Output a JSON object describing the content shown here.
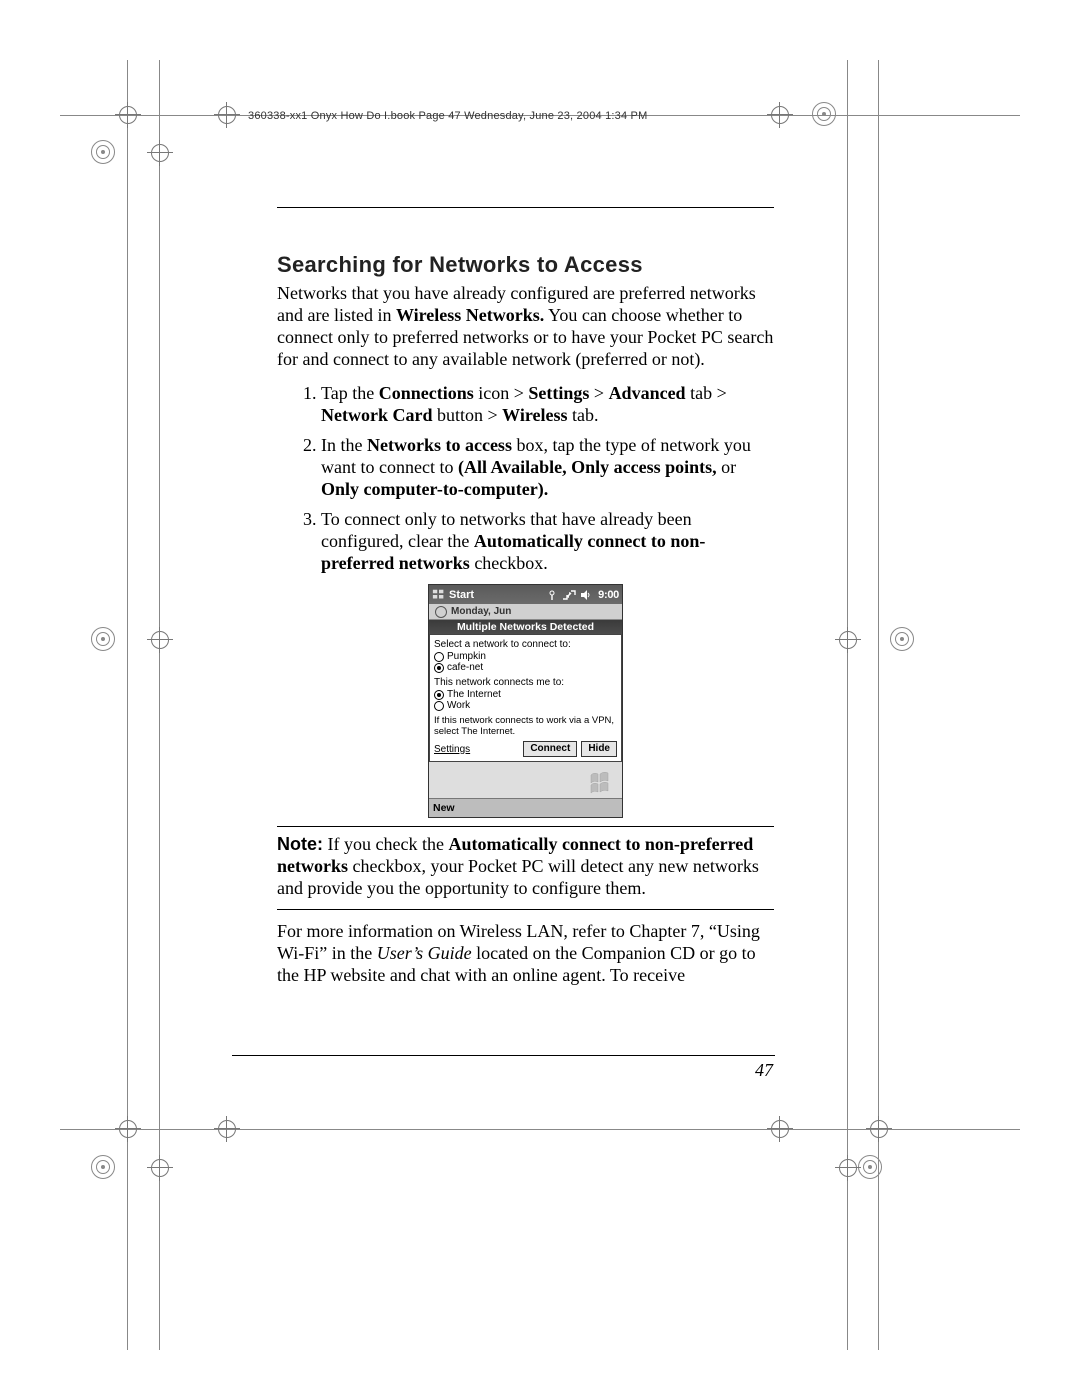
{
  "meta_line": "360338-xx1 Onyx How Do I.book  Page 47  Wednesday, June 23, 2004  1:34 PM",
  "page_number": "47",
  "heading": "Searching for Networks to Access",
  "intro": {
    "pre": "Networks that you have already configured are preferred networks and are listed in ",
    "b1": "Wireless Networks.",
    "post": " You can choose whether to connect only to preferred networks or to have your Pocket PC search for and connect to any available network (preferred or not)."
  },
  "steps": {
    "s1": {
      "pre": "Tap the ",
      "b1": "Connections",
      "mid1": " icon > ",
      "b2": "Settings",
      "mid2": " > ",
      "b3": "Advanced",
      "mid3": " tab > ",
      "b4": "Network Card",
      "mid4": " button > ",
      "b5": "Wireless",
      "post": " tab."
    },
    "s2": {
      "pre": "In the ",
      "b1": "Networks to access",
      "mid1": " box, tap the type of network you want to connect to ",
      "b2": "(All Available, Only access points,",
      "mid2": " or ",
      "b3": "Only computer-to-computer)."
    },
    "s3": {
      "pre": "To connect only to networks that have already been configured, clear the ",
      "b1": "Automatically connect to non-preferred networks",
      "post": " checkbox."
    }
  },
  "ppc": {
    "start": "Start",
    "clock": "9:00",
    "date_strip": "Monday, Jun",
    "header": "Multiple Networks Detected",
    "select_label": "Select a network to connect to:",
    "net1": "Pumpkin",
    "net2": "cafe-net",
    "connects_label": "This network connects me to:",
    "opt_internet": "The Internet",
    "opt_work": "Work",
    "vpn_note": "If this network connects to work via a VPN, select The Internet.",
    "settings": "Settings",
    "btn_connect": "Connect",
    "btn_hide": "Hide",
    "bottom_new": "New"
  },
  "note": {
    "label": "Note:",
    "pre": " If you check the ",
    "b1": "Automatically connect to non-preferred networks",
    "post": " checkbox, your Pocket PC will detect any new networks and provide you the opportunity to configure them."
  },
  "more_info": {
    "pre": "For more information on Wireless LAN, refer to Chapter 7, “Using Wi-Fi” in the ",
    "i1": "User’s Guide",
    "post": " located on the Companion CD or go to the HP website and chat with an online agent. To receive"
  }
}
